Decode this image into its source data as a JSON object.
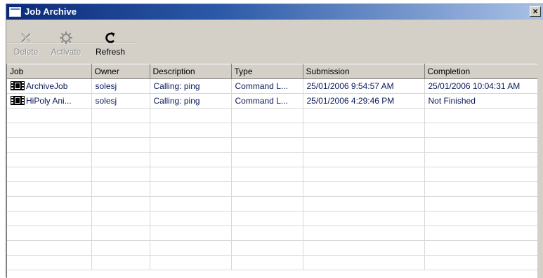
{
  "window": {
    "title": "Job Archive",
    "close_glyph": "×"
  },
  "toolbar": {
    "buttons": [
      {
        "label": "Delete",
        "icon": "delete-x-icon",
        "enabled": false
      },
      {
        "label": "Activate",
        "icon": "activate-gear-icon",
        "enabled": false
      },
      {
        "label": "Refresh",
        "icon": "refresh-icon",
        "enabled": true
      }
    ]
  },
  "table": {
    "columns": [
      "Job",
      "Owner",
      "Description",
      "Type",
      "Submission",
      "Completion"
    ],
    "rows": [
      {
        "job": "ArchiveJob",
        "owner": "solesj",
        "description": "Calling: ping",
        "type": "Command L...",
        "submission": "25/01/2006 9:54:57 AM",
        "completion": "25/01/2006 10:04:31 AM",
        "icon": "film-job-icon"
      },
      {
        "job": "HiPoly Ani...",
        "owner": "solesj",
        "description": "Calling: ping",
        "type": "Command L...",
        "submission": "25/01/2006 4:29:46 PM",
        "completion": "Not Finished",
        "icon": "film-job-icon"
      }
    ]
  },
  "colors": {
    "titlebar_start": "#0b2a7a",
    "titlebar_end": "#a9c1e6",
    "chrome": "#d4d0c8",
    "row_text": "#0a1a5a"
  }
}
